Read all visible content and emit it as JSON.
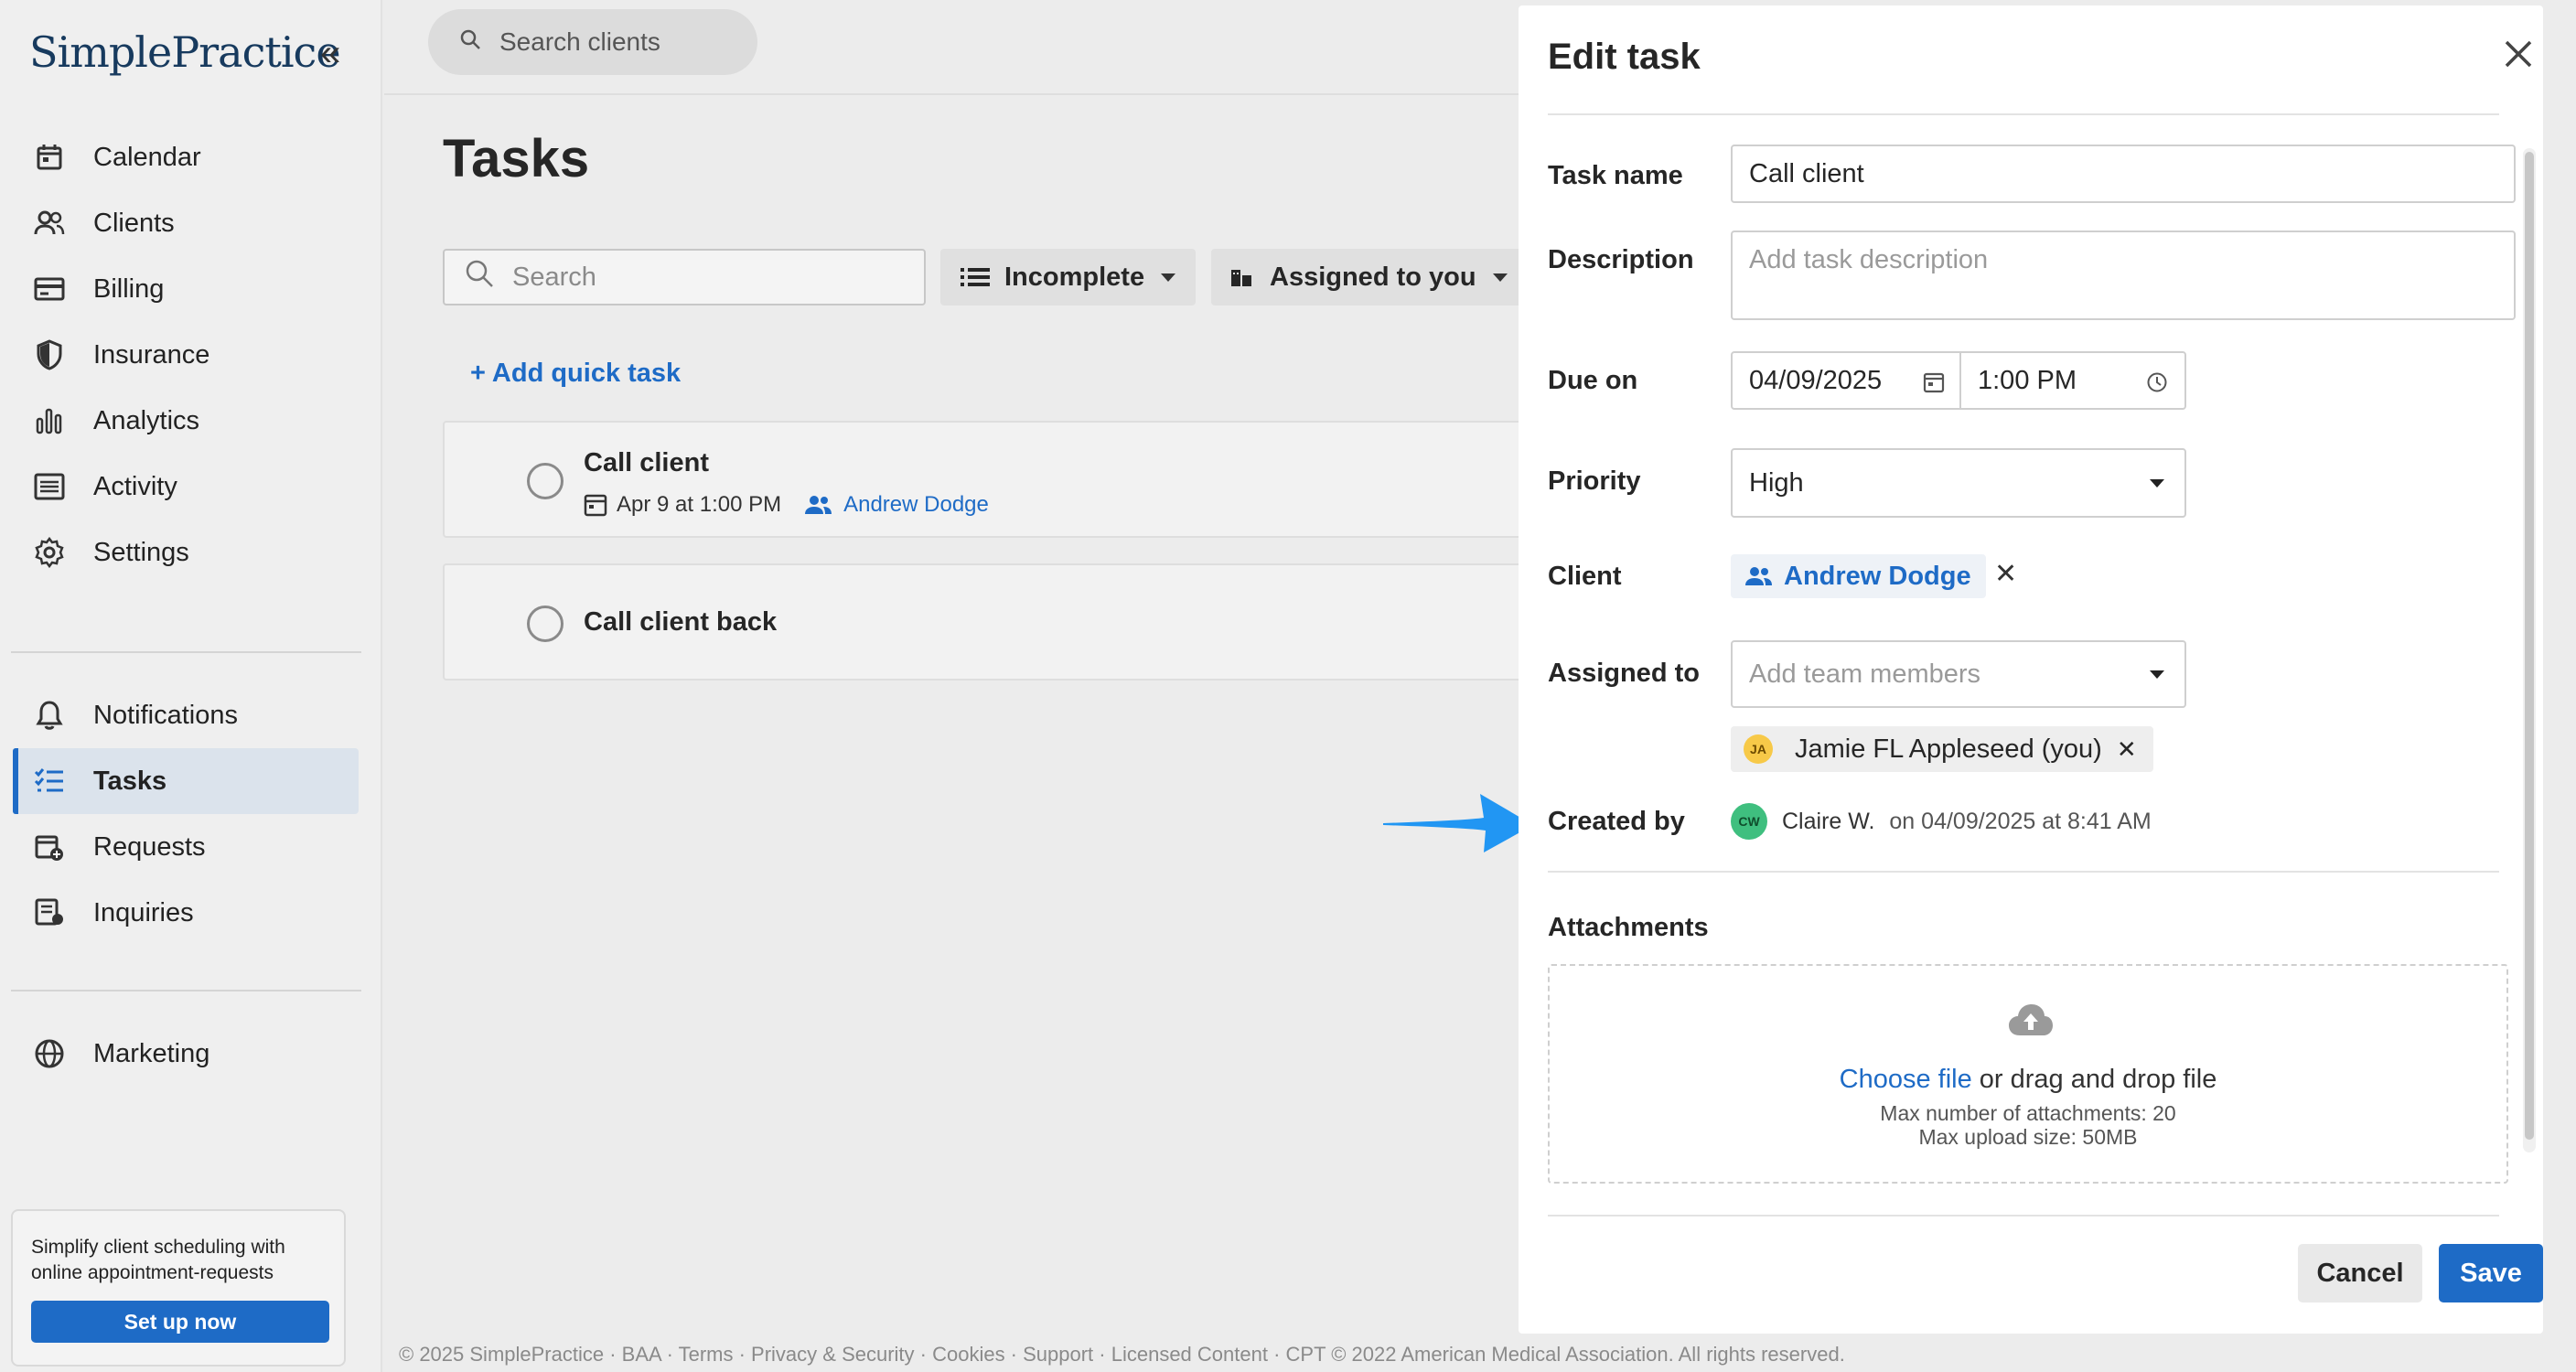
{
  "sidebar": {
    "logo": "SimplePractice",
    "items_primary": [
      {
        "label": "Calendar",
        "icon": "calendar-icon"
      },
      {
        "label": "Clients",
        "icon": "clients-icon"
      },
      {
        "label": "Billing",
        "icon": "billing-icon"
      },
      {
        "label": "Insurance",
        "icon": "shield-icon"
      },
      {
        "label": "Analytics",
        "icon": "analytics-icon"
      },
      {
        "label": "Activity",
        "icon": "activity-icon"
      },
      {
        "label": "Settings",
        "icon": "gear-icon"
      }
    ],
    "items_secondary": [
      {
        "label": "Notifications",
        "icon": "bell-icon"
      },
      {
        "label": "Tasks",
        "icon": "tasks-icon",
        "active": true
      },
      {
        "label": "Requests",
        "icon": "requests-icon"
      },
      {
        "label": "Inquiries",
        "icon": "inquiries-icon"
      }
    ],
    "items_tertiary": [
      {
        "label": "Marketing",
        "icon": "globe-icon"
      }
    ],
    "promo": {
      "text": "Simplify client scheduling with online appointment-requests",
      "button": "Set up now"
    }
  },
  "topbar": {
    "search_placeholder": "Search clients"
  },
  "main": {
    "title": "Tasks",
    "search_placeholder": "Search",
    "filter_status": "Incomplete",
    "filter_assignee": "Assigned to you",
    "add_quick_task": "+ Add quick task",
    "tasks": [
      {
        "name": "Call client",
        "date": "Apr 9 at 1:00 PM",
        "client": "Andrew Dodge"
      },
      {
        "name": "Call client back"
      }
    ]
  },
  "footer": "© 2025 SimplePractice · BAA · Terms · Privacy & Security · Cookies · Support · Licensed Content · CPT © 2022 American Medical Association. All rights reserved.",
  "modal": {
    "title": "Edit task",
    "task_name_label": "Task name",
    "task_name_value": "Call client",
    "description_label": "Description",
    "description_placeholder": "Add task description",
    "due_label": "Due on",
    "due_date": "04/09/2025",
    "due_time": "1:00 PM",
    "priority_label": "Priority",
    "priority_value": "High",
    "client_label": "Client",
    "client_value": "Andrew Dodge",
    "assigned_label": "Assigned to",
    "assigned_placeholder": "Add team members",
    "assigned_member": "Jamie FL Appleseed (you)",
    "assigned_member_initials": "JA",
    "created_label": "Created by",
    "created_by": "Claire W.",
    "created_by_initials": "CW",
    "created_on": "on 04/09/2025 at 8:41 AM",
    "attachments_label": "Attachments",
    "choose_file": "Choose file",
    "drag_text": " or drag and drop file",
    "max_attachments": "Max number of attachments: 20",
    "max_size": "Max upload size: 50MB",
    "cancel": "Cancel",
    "save": "Save"
  },
  "colors": {
    "accent": "#1e6bc6",
    "arrow": "#2196f3",
    "avatar_ja": "#f7c948",
    "avatar_cw": "#3fbf7f"
  }
}
